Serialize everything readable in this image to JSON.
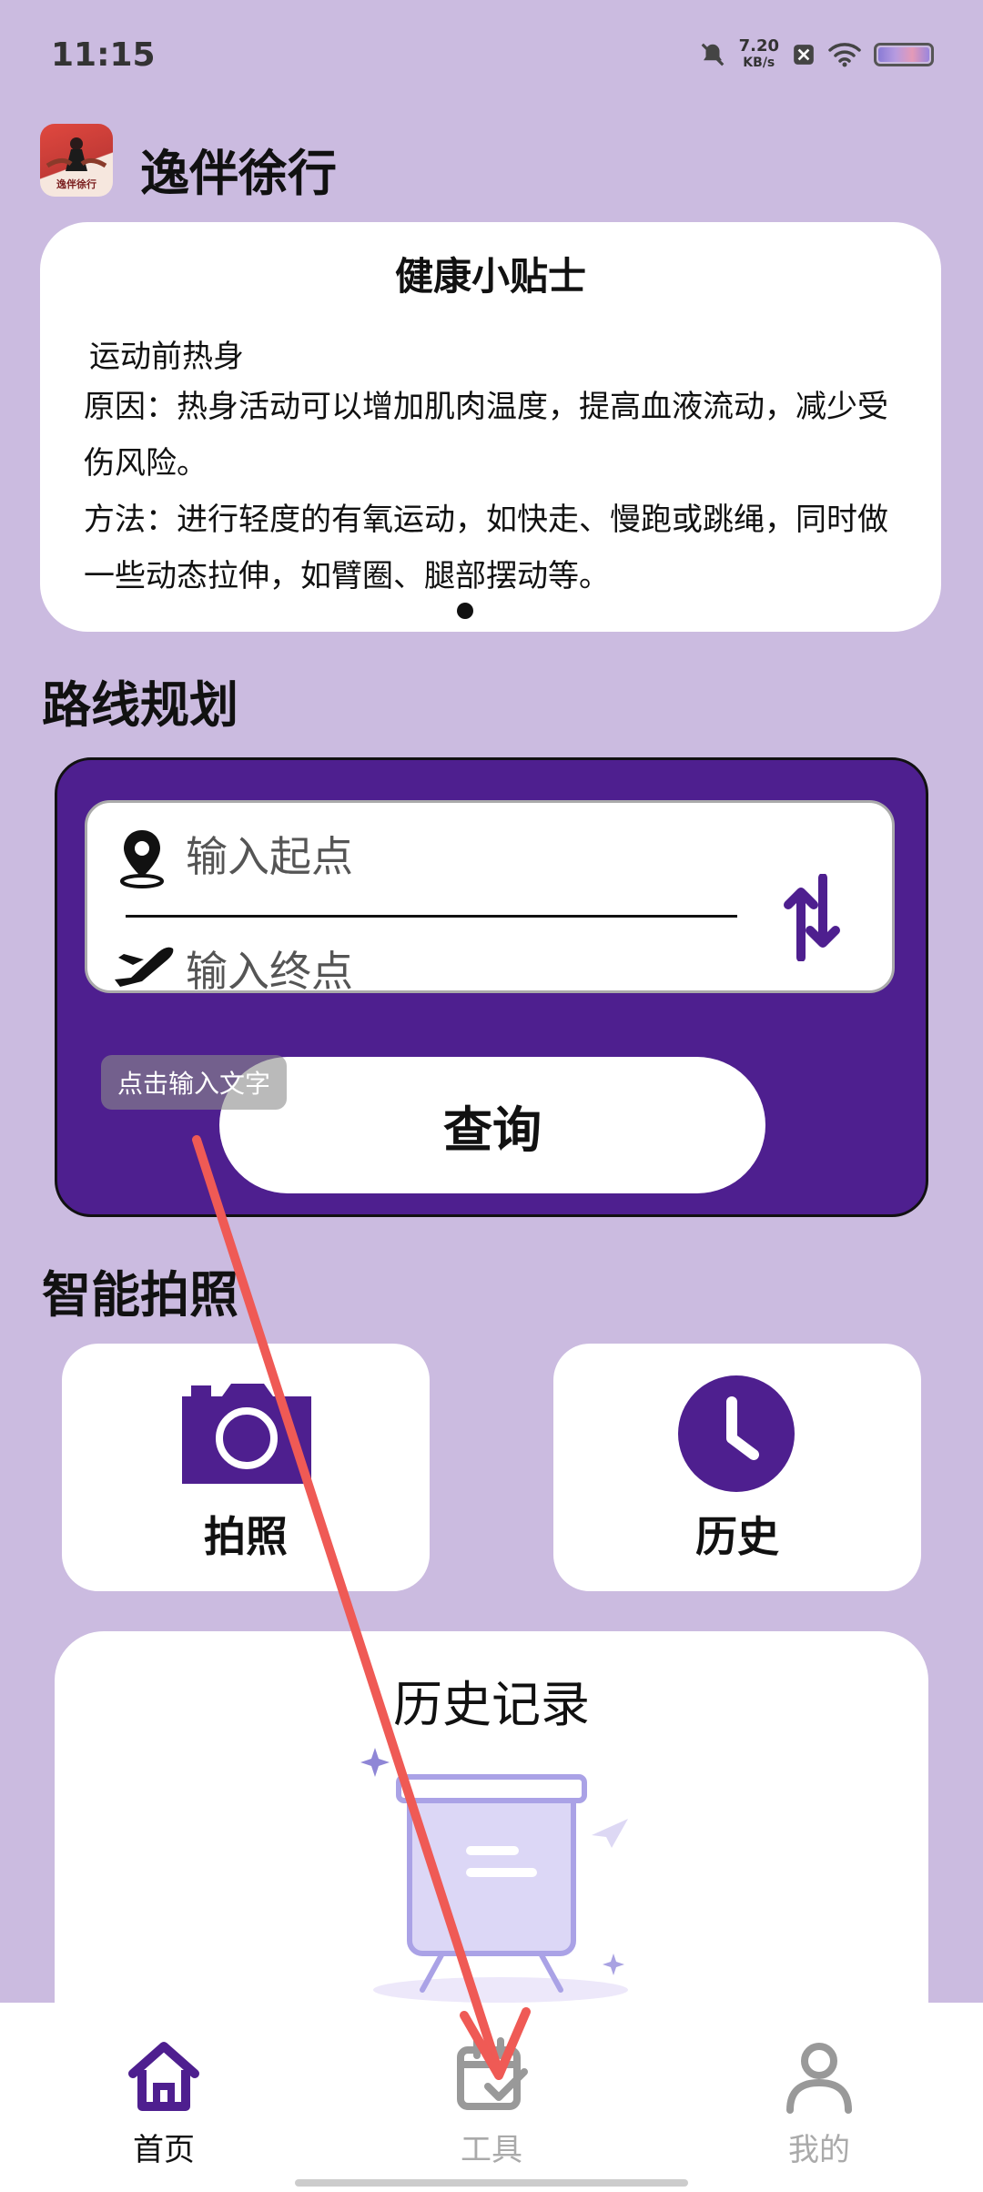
{
  "status_bar": {
    "time": "11:15",
    "net_speed_value": "7.20",
    "net_speed_unit": "KB/s"
  },
  "app": {
    "title": "逸伴徐行",
    "logo_text": "逸伴徐行"
  },
  "health_tips": {
    "title": "健康小贴士",
    "subtitle": "运动前热身",
    "reason": "原因：热身活动可以增加肌肉温度，提高血液流动，减少受伤风险。",
    "method": "方法：进行轻度的有氧运动，如快走、慢跑或跳绳，同时做一些动态拉伸，如臂圈、腿部摆动等。"
  },
  "route_planning": {
    "section_title": "路线规划",
    "start_placeholder": "输入起点",
    "end_placeholder": "输入终点",
    "query_label": "查询",
    "hint": "点击输入文字"
  },
  "smart_photo": {
    "section_title": "智能拍照",
    "photo_label": "拍照",
    "history_label": "历史"
  },
  "history": {
    "title": "历史记录"
  },
  "bottom_nav": {
    "items": [
      {
        "label": "首页",
        "icon": "home-icon",
        "active": true
      },
      {
        "label": "工具",
        "icon": "tools-icon",
        "active": false
      },
      {
        "label": "我的",
        "icon": "profile-icon",
        "active": false
      }
    ]
  },
  "colors": {
    "background": "#cbbbe0",
    "accent": "#4e1f8f",
    "annotation_arrow": "#ef5a55"
  }
}
